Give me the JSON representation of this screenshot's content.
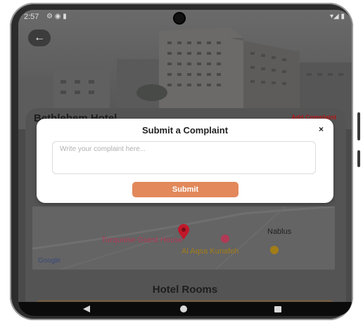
{
  "statusbar": {
    "time": "2:57"
  },
  "header": {
    "hotel_name": "Bethlehem Hotel",
    "add_complaint": "Add Complaint"
  },
  "modal": {
    "title": "Submit a Complaint",
    "close": "×",
    "placeholder": "Write your complaint here...",
    "value": "",
    "submit": "Submit"
  },
  "map": {
    "labels": {
      "place1": "Turquoise Guest House",
      "place2": "Al Aqsa Kunafeh",
      "city": "Nablus",
      "provider": "Google"
    },
    "colors": {
      "place1": "#b03a56",
      "place2": "#a27c17",
      "pin": "#c0182a"
    }
  },
  "rooms": {
    "title": "Hotel Rooms"
  },
  "colors": {
    "accent": "#e2885b",
    "complaint_link": "#b01818"
  }
}
